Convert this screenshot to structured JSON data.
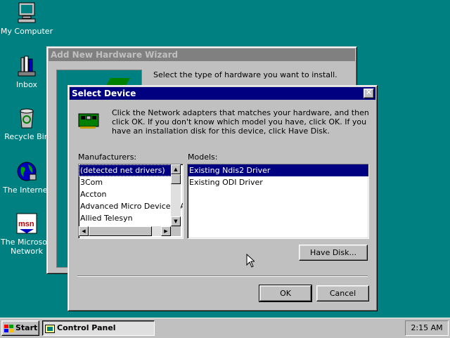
{
  "desktop": {
    "icons": [
      {
        "label": "My Computer"
      },
      {
        "label": "Inbox"
      },
      {
        "label": "Recycle Bin"
      },
      {
        "label": "The Internet"
      },
      {
        "label": "The Microsoft Network"
      }
    ]
  },
  "wizard": {
    "title": "Add New Hardware Wizard",
    "instruction": "Select the type of hardware you want to install."
  },
  "dialog": {
    "title": "Select Device",
    "message": "Click the Network adapters that matches your hardware, and then click OK. If you don't know which model you have, click OK. If you have an installation disk for this device, click Have Disk.",
    "manufacturers_label": "Manufacturers:",
    "manufacturers": [
      "(detected net drivers)",
      "3Com",
      "Accton",
      "Advanced Micro Devices (A",
      "Allied Telesyn"
    ],
    "models_label": "Models:",
    "models": [
      "Existing Ndis2 Driver",
      "Existing ODI Driver"
    ],
    "have_disk_label": "Have Disk...",
    "ok_label": "OK",
    "cancel_label": "Cancel"
  },
  "taskbar": {
    "start_label": "Start",
    "task_label": "Control Panel",
    "clock": "2:15 AM"
  }
}
